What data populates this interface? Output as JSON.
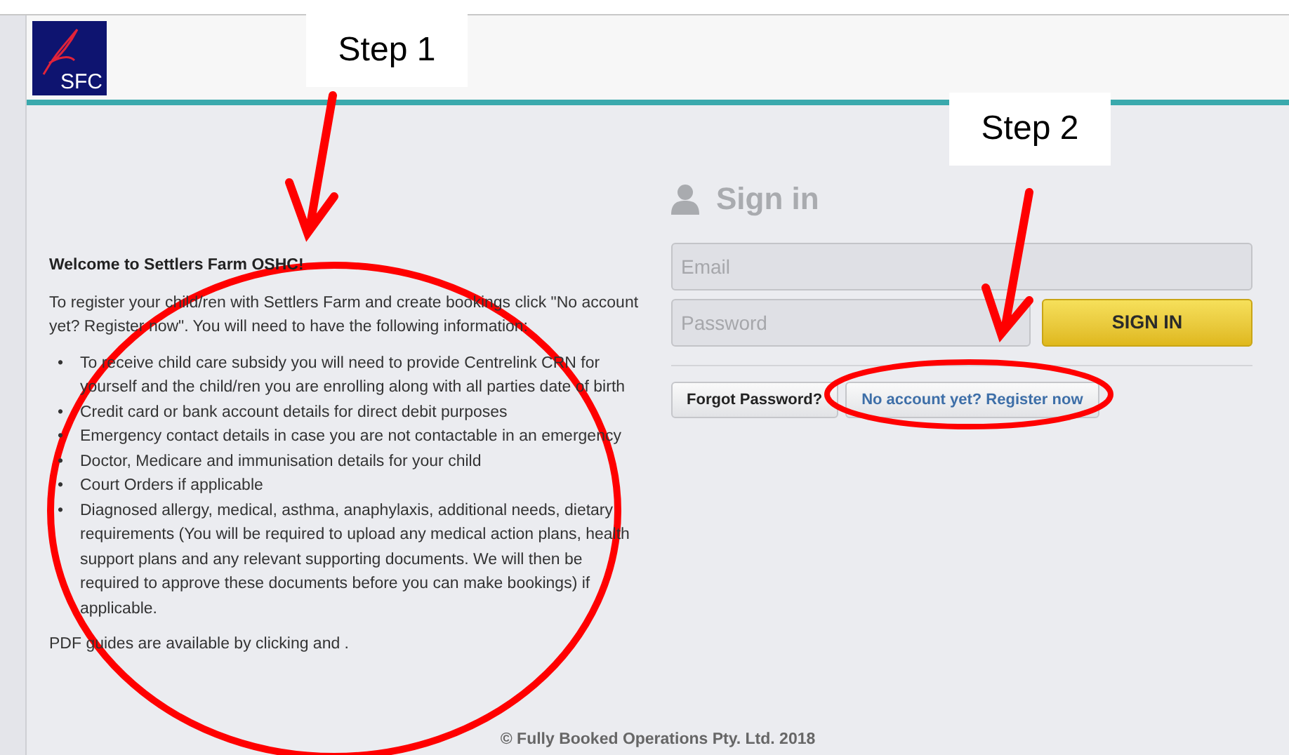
{
  "header": {
    "logo_text": "SFC"
  },
  "welcome": {
    "title": "Welcome to Settlers Farm OSHC!",
    "intro": "To register your child/ren with Settlers Farm and create bookings click \"No account yet? Register now\". You will need to have the following information:",
    "items": [
      {
        "bullet": "•",
        "text": "To receive child care subsidy you will need to provide Centrelink CRN for yourself and the child/ren you are enrolling along with all parties date of birth"
      },
      {
        "bullet": "•",
        "text": "Credit card or bank account details for direct debit purposes"
      },
      {
        "bullet": "•",
        "text": "Emergency contact details in case you are not contactable in an emergency"
      },
      {
        "bullet": "•",
        "text": "Doctor, Medicare and immunisation details for your child"
      },
      {
        "bullet": "•",
        "text": "Court Orders if applicable"
      },
      {
        "bullet": "•",
        "text": "Diagnosed allergy, medical, asthma, anaphylaxis, additional needs, dietary requirements (You will be required to upload any medical action plans, health support plans and any relevant supporting documents. We will then be required to approve these documents before you can make bookings) if applicable."
      }
    ],
    "pdf_note": "PDF guides are available by clicking  and ."
  },
  "sign_in": {
    "heading": "Sign in",
    "email": {
      "placeholder": "Email"
    },
    "password": {
      "placeholder": "Password"
    },
    "submit": "SIGN IN",
    "forgot": "Forgot Password?",
    "register": "No account yet? Register now"
  },
  "footer": "© Fully Booked Operations Pty. Ltd. 2018",
  "annotations": [
    {
      "kind": "step",
      "label": "Step 1"
    },
    {
      "kind": "step",
      "label": "Step 2"
    }
  ]
}
